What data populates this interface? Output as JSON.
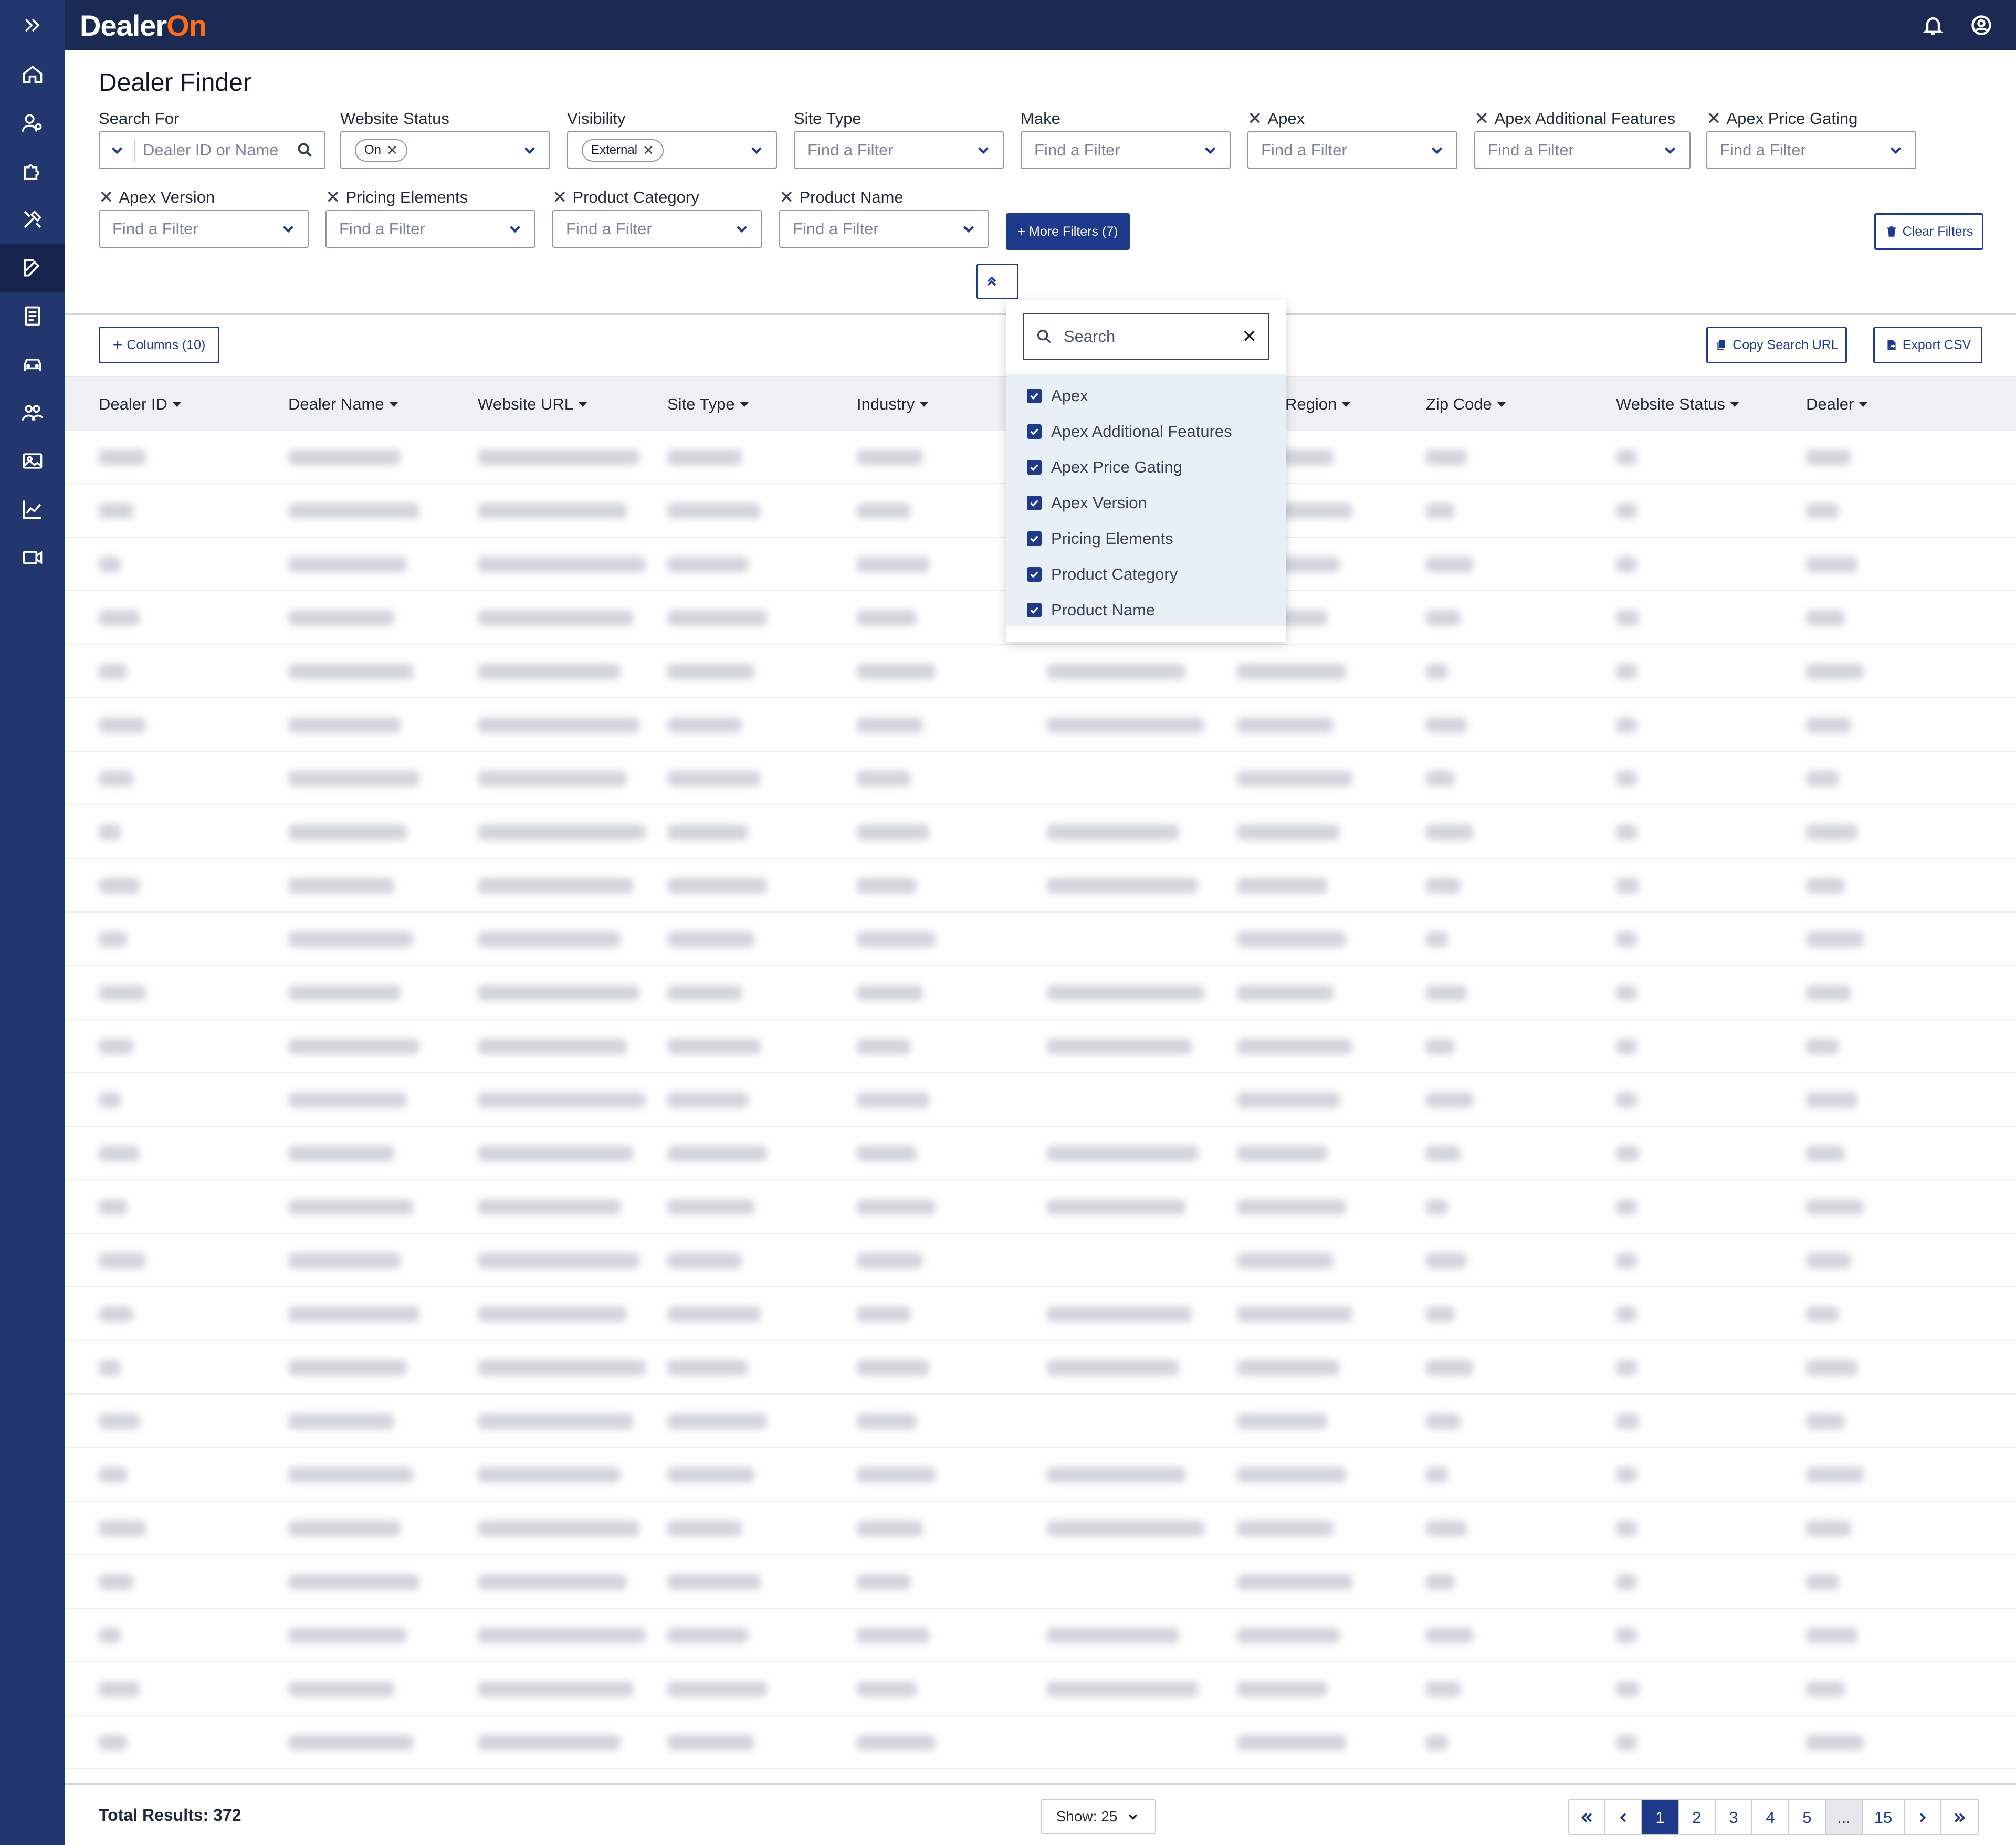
{
  "app": {
    "logo_prefix": "Dealer",
    "logo_suffix": "On"
  },
  "page": {
    "title": "Dealer Finder"
  },
  "filters": {
    "search_for": {
      "label": "Search For",
      "placeholder": "Dealer ID or Name"
    },
    "website_status": {
      "label": "Website Status",
      "chip": "On"
    },
    "visibility": {
      "label": "Visibility",
      "chip": "External"
    },
    "site_type": {
      "label": "Site Type",
      "placeholder": "Find a Filter"
    },
    "make": {
      "label": "Make",
      "placeholder": "Find a Filter"
    },
    "apex": {
      "label": "Apex",
      "placeholder": "Find a Filter"
    },
    "apex_additional": {
      "label": "Apex Additional Features",
      "placeholder": "Find a Filter"
    },
    "apex_price_gating": {
      "label": "Apex Price Gating",
      "placeholder": "Find a Filter"
    },
    "apex_version": {
      "label": "Apex Version",
      "placeholder": "Find a Filter"
    },
    "pricing_elements": {
      "label": "Pricing Elements",
      "placeholder": "Find a Filter"
    },
    "product_category": {
      "label": "Product Category",
      "placeholder": "Find a Filter"
    },
    "product_name": {
      "label": "Product Name",
      "placeholder": "Find a Filter"
    },
    "more_filters": "+ More Filters (7)",
    "clear_filters": "Clear Filters"
  },
  "toolbar": {
    "columns": "Columns (10)",
    "copy_url": "Copy Search URL",
    "export_csv": "Export CSV"
  },
  "table": {
    "columns": [
      "Dealer ID",
      "Dealer Name",
      "Website URL",
      "Site Type",
      "Industry",
      "Region",
      "Zip Code",
      "Website Status",
      "Dealer"
    ]
  },
  "more_filters_dropdown": {
    "search_placeholder": "Search",
    "items": [
      "Apex",
      "Apex Additional Features",
      "Apex Price Gating",
      "Apex Version",
      "Pricing Elements",
      "Product Category",
      "Product Name"
    ]
  },
  "footer": {
    "total": "Total Results: 372",
    "show": "Show: 25",
    "pages": [
      "1",
      "2",
      "3",
      "4",
      "5",
      "...",
      "15"
    ]
  }
}
